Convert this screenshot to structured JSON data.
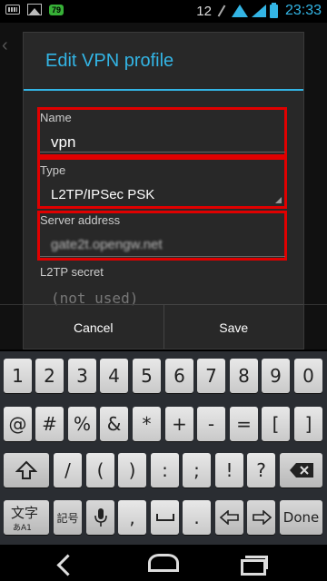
{
  "status_bar": {
    "battery_badge": "79",
    "notification_count": "12",
    "time": "23:33"
  },
  "dialog": {
    "title": "Edit VPN profile",
    "fields": {
      "name": {
        "label": "Name",
        "value": "vpn"
      },
      "type": {
        "label": "Type",
        "value": "L2TP/IPSec PSK"
      },
      "server": {
        "label": "Server address",
        "value": "gate2t.opengw.net"
      },
      "l2tp_secret": {
        "label": "L2TP secret",
        "placeholder": "(not used)"
      }
    },
    "buttons": {
      "cancel": "Cancel",
      "save": "Save"
    }
  },
  "keyboard": {
    "row1": [
      "1",
      "2",
      "3",
      "4",
      "5",
      "6",
      "7",
      "8",
      "9",
      "0"
    ],
    "row2": [
      "@",
      "#",
      "%",
      "&",
      "*",
      "+",
      "-",
      "=",
      "[",
      "]"
    ],
    "row3": [
      ":",
      "/",
      "(",
      ")",
      ":",
      ";",
      "!",
      "?"
    ],
    "bottom": {
      "mode_main": "文字",
      "mode_sub": "あA1",
      "symbols": "記号",
      "comma": ",",
      "period": ".",
      "done": "Done"
    }
  },
  "colors": {
    "accent": "#33b5e5",
    "highlight": "#e00000",
    "dialog_bg": "#282828"
  }
}
